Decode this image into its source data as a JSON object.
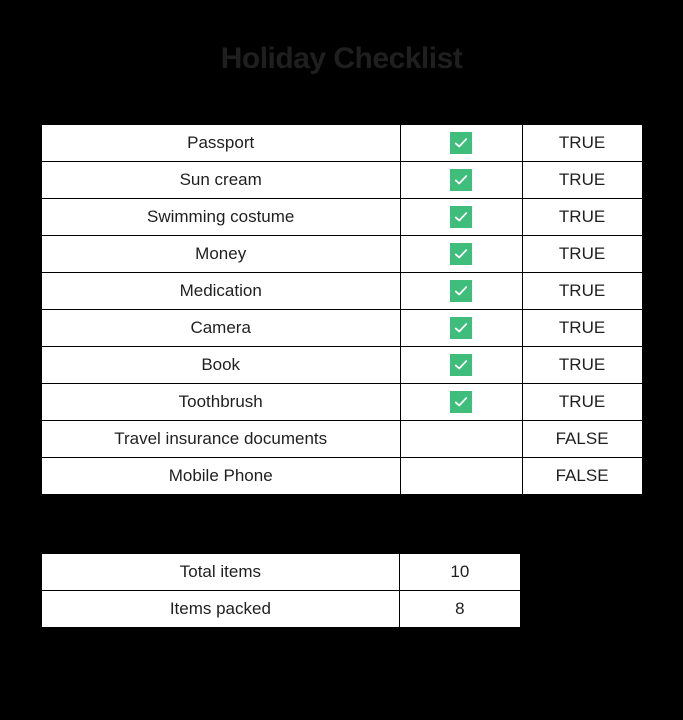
{
  "title": "Holiday Checklist",
  "items": [
    {
      "name": "Passport",
      "checked": true,
      "status": "TRUE"
    },
    {
      "name": "Sun cream",
      "checked": true,
      "status": "TRUE"
    },
    {
      "name": "Swimming costume",
      "checked": true,
      "status": "TRUE"
    },
    {
      "name": "Money",
      "checked": true,
      "status": "TRUE"
    },
    {
      "name": "Medication",
      "checked": true,
      "status": "TRUE"
    },
    {
      "name": "Camera",
      "checked": true,
      "status": "TRUE"
    },
    {
      "name": "Book",
      "checked": true,
      "status": "TRUE"
    },
    {
      "name": "Toothbrush",
      "checked": true,
      "status": "TRUE"
    },
    {
      "name": "Travel insurance documents",
      "checked": false,
      "status": "FALSE"
    },
    {
      "name": "Mobile Phone",
      "checked": false,
      "status": "FALSE"
    }
  ],
  "summary": {
    "total_label": "Total items",
    "total_value": "10",
    "packed_label": "Items packed",
    "packed_value": "8"
  }
}
